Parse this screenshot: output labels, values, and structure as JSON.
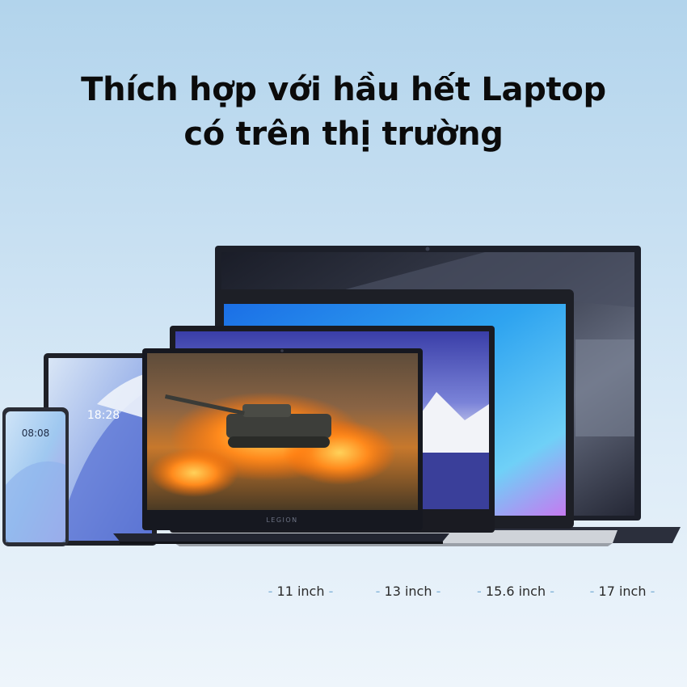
{
  "headline": {
    "line1": "Thích hợp với hầu hết Laptop",
    "line2": "có trên thị trường"
  },
  "phone": {
    "time": "08:08"
  },
  "tablet": {
    "time": "18:28"
  },
  "legion_laptop": {
    "brand": "LEGION"
  },
  "sizes": [
    {
      "label": "11 inch"
    },
    {
      "label": "13 inch"
    },
    {
      "label": "15.6 inch"
    },
    {
      "label": "17 inch"
    }
  ]
}
